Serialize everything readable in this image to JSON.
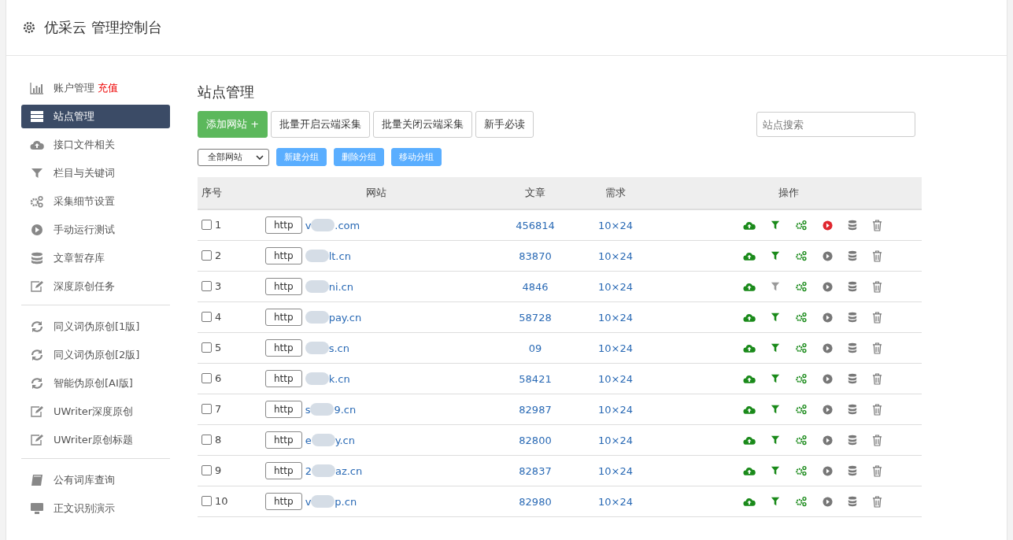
{
  "header": {
    "title": "优采云 管理控制台"
  },
  "sidebar": {
    "groups": [
      {
        "items": [
          {
            "label": "账户管理",
            "badge": "充值",
            "kind": "chart",
            "selected": false
          },
          {
            "label": "站点管理",
            "kind": "server",
            "selected": true
          },
          {
            "label": "接口文件相关",
            "kind": "cloud",
            "selected": false
          },
          {
            "label": "栏目与关键词",
            "kind": "filter",
            "selected": false
          },
          {
            "label": "采集细节设置",
            "kind": "gears",
            "selected": false
          },
          {
            "label": "手动运行测试",
            "kind": "play",
            "selected": false
          },
          {
            "label": "文章暂存库",
            "kind": "database",
            "selected": false
          },
          {
            "label": "深度原创任务",
            "kind": "edit",
            "selected": false
          }
        ]
      },
      {
        "items": [
          {
            "label": "同义词伪原创[1版]",
            "kind": "refresh",
            "selected": false
          },
          {
            "label": "同义词伪原创[2版]",
            "kind": "refresh",
            "selected": false
          },
          {
            "label": "智能伪原创[AI版]",
            "kind": "refresh",
            "selected": false
          },
          {
            "label": "UWriter深度原创",
            "kind": "edit",
            "selected": false
          },
          {
            "label": "UWriter原创标题",
            "kind": "edit",
            "selected": false
          }
        ]
      },
      {
        "items": [
          {
            "label": "公有词库查询",
            "kind": "book",
            "selected": false
          },
          {
            "label": "正文识别演示",
            "kind": "monitor",
            "selected": false
          }
        ]
      }
    ]
  },
  "page": {
    "title": "站点管理",
    "primary_button": "添加网站 +",
    "buttons": [
      "批量开启云端采集",
      "批量关闭云端采集",
      "新手必读"
    ],
    "search": {
      "placeholder": "站点搜索"
    },
    "group_select": "全部网站",
    "group_buttons": [
      "新建分组",
      "删除分组",
      "移动分组"
    ]
  },
  "table": {
    "columns": [
      "序号",
      "网站",
      "文章",
      "需求",
      "操作"
    ],
    "rows": [
      {
        "index": "1",
        "checked": false,
        "protocol": "http",
        "domain_head": "v",
        "domain_tail": ".com",
        "articles": "456814",
        "demand": "10×24",
        "running": true,
        "filter_on": true
      },
      {
        "index": "2",
        "checked": false,
        "protocol": "http",
        "domain_tail": "lt.cn",
        "articles": "83870",
        "demand": "10×24",
        "running": false,
        "filter_on": true
      },
      {
        "index": "3",
        "checked": false,
        "protocol": "http",
        "domain_tail": "ni.cn",
        "articles": "4846",
        "demand": "10×24",
        "running": false,
        "filter_on": false
      },
      {
        "index": "4",
        "checked": false,
        "protocol": "http",
        "domain_tail": "pay.cn",
        "articles": "58728",
        "demand": "10×24",
        "running": false,
        "filter_on": true
      },
      {
        "index": "5",
        "checked": false,
        "protocol": "http",
        "domain_tail": "s.cn",
        "articles": "09",
        "demand": "10×24",
        "running": false,
        "filter_on": true
      },
      {
        "index": "6",
        "checked": false,
        "protocol": "http",
        "domain_tail": "k.cn",
        "articles": "58421",
        "demand": "10×24",
        "running": false,
        "filter_on": true
      },
      {
        "index": "7",
        "checked": false,
        "protocol": "http",
        "domain_head": "s",
        "domain_tail": "9.cn",
        "articles": "82987",
        "demand": "10×24",
        "running": false,
        "filter_on": true
      },
      {
        "index": "8",
        "checked": false,
        "protocol": "http",
        "domain_head": "e",
        "domain_tail": "y.cn",
        "articles": "82800",
        "demand": "10×24",
        "running": false,
        "filter_on": true
      },
      {
        "index": "9",
        "checked": false,
        "protocol": "http",
        "domain_head": "2",
        "domain_tail": "az.cn",
        "articles": "82837",
        "demand": "10×24",
        "running": false,
        "filter_on": true
      },
      {
        "index": "10",
        "checked": false,
        "protocol": "http",
        "domain_head": "v",
        "domain_tail": "p.cn",
        "articles": "82980",
        "demand": "10×24",
        "running": false,
        "filter_on": true
      }
    ]
  }
}
